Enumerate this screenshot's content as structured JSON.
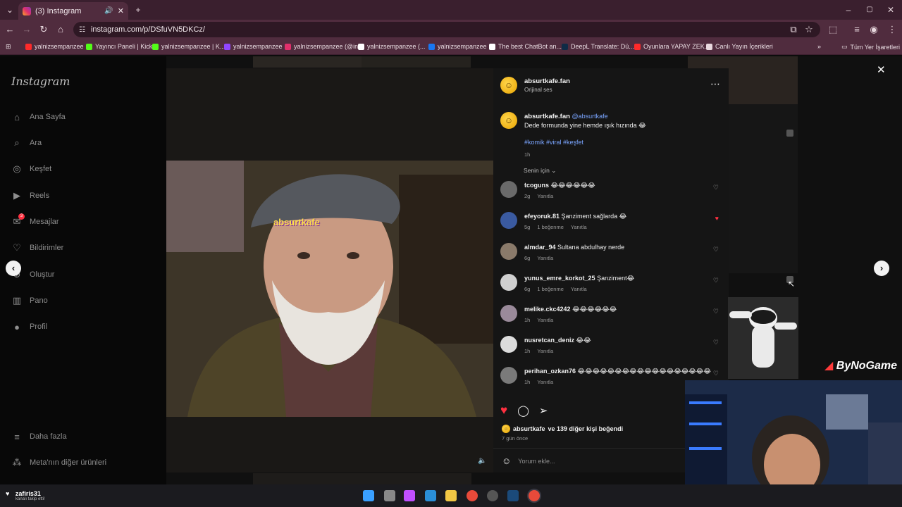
{
  "browser": {
    "tab_title": "(3) Instagram",
    "url": "instagram.com/p/DSfuVN5DKCz/",
    "bookmarks": [
      {
        "label": "yalnizsempanzee",
        "color": "#ff2a2a"
      },
      {
        "label": "Yayıncı Paneli | Kick",
        "color": "#53fc18"
      },
      {
        "label": "yalnizsempanzee | K...",
        "color": "#53fc18"
      },
      {
        "label": "yalnizsempanzee",
        "color": "#9146ff"
      },
      {
        "label": "yalnizsempanzee (@in...",
        "color": "#e1306c"
      },
      {
        "label": "yalnizsempanzee (...",
        "color": "#ffffff"
      },
      {
        "label": "yalnizsempanzee",
        "color": "#1877f2"
      },
      {
        "label": "The best ChatBot an...",
        "color": "#ffffff"
      },
      {
        "label": "DeepL Translate: Dü...",
        "color": "#0f2b46"
      },
      {
        "label": "Oyunlara YAPAY ZEK...",
        "color": "#ff2a2a"
      },
      {
        "label": "Canlı Yayın İçerikleri",
        "color": "#e8d8de"
      }
    ],
    "all_bookmarks": "Tüm Yer İşaretleri"
  },
  "sidebar": {
    "logo": "Instagram",
    "items": [
      {
        "label": "Ana Sayfa",
        "icon": "home-icon"
      },
      {
        "label": "Ara",
        "icon": "search-icon"
      },
      {
        "label": "Keşfet",
        "icon": "compass-icon"
      },
      {
        "label": "Reels",
        "icon": "reels-icon"
      },
      {
        "label": "Mesajlar",
        "icon": "messenger-icon"
      },
      {
        "label": "Bildirimler",
        "icon": "heart-icon"
      },
      {
        "label": "Oluştur",
        "icon": "plus-icon"
      },
      {
        "label": "Pano",
        "icon": "chart-icon"
      },
      {
        "label": "Profil",
        "icon": "profile-icon"
      }
    ],
    "more": "Daha fazla",
    "meta": "Meta'nın diğer ürünleri",
    "messages_badge": "3"
  },
  "video": {
    "watermark": "absurtkafe"
  },
  "post": {
    "author": "absurtkafe.fan",
    "audio": "Orijinal ses",
    "caption_user": "absurtkafe.fan",
    "caption_mention": "@absurtkafe",
    "caption_text": "Dede formunda yine hemde ışık hızında 😂",
    "hashtags": "#komik #viral #keşfet",
    "caption_time": "1h",
    "sort": "Senin için",
    "comments": [
      {
        "user": "tcoguns",
        "text": "😂😂😂😂😂😂",
        "time": "2g",
        "likes": "",
        "reply": "Yanıtla",
        "liked": false,
        "avatar_color": "#6a6a6a"
      },
      {
        "user": "efeyoruk.81",
        "text": "Şanziment sağlarda 😂",
        "time": "5g",
        "likes": "1 beğenme",
        "reply": "Yanıtla",
        "liked": true,
        "avatar_color": "#3a5aa0"
      },
      {
        "user": "almdar_94",
        "text": "Sultana abdulhay nerde",
        "time": "6g",
        "likes": "",
        "reply": "Yanıtla",
        "liked": false,
        "avatar_color": "#8a7a6a"
      },
      {
        "user": "yunus_emre_korkot_25",
        "text": "Şanziment😂",
        "time": "6g",
        "likes": "1 beğenme",
        "reply": "Yanıtla",
        "liked": false,
        "avatar_color": "#d0d0d0"
      },
      {
        "user": "melike.ckc4242",
        "text": "😂😂😂😂😂😂",
        "time": "1h",
        "likes": "",
        "reply": "Yanıtla",
        "liked": false,
        "avatar_color": "#9a8a9a"
      },
      {
        "user": "nusretcan_deniz",
        "text": "😂😂",
        "time": "1h",
        "likes": "",
        "reply": "Yanıtla",
        "liked": false,
        "avatar_color": "#dcdcdc"
      },
      {
        "user": "perihan_ozkan76",
        "text": "😂😂😂😂😂😂😂😂😂😂😂😂😂😂😂😂😂😂",
        "time": "1h",
        "likes": "",
        "reply": "Yanıtla",
        "liked": false,
        "avatar_color": "#7a7a7a"
      }
    ],
    "liked_by_user": "absurtkafe",
    "liked_by_rest": "ve 139 diğer kişi beğendi",
    "date": "7 gün önce",
    "add_comment_placeholder": "Yorum ekle..."
  },
  "overlay": {
    "brand": "ByNoGame",
    "follower_name": "zafiris31",
    "follower_text": "kanalı takip etti!"
  }
}
